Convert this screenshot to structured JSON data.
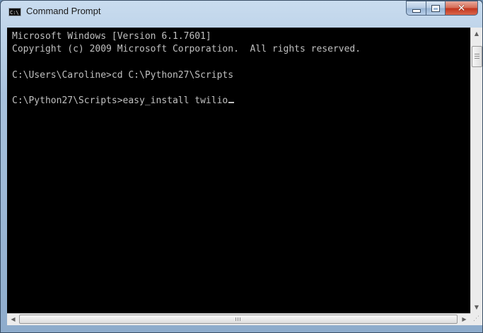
{
  "window": {
    "title": "Command Prompt",
    "icon": "cmd-app-icon",
    "icon_text": "C:\\",
    "buttons": {
      "minimize_icon": "minimize-icon",
      "maximize_icon": "maximize-icon",
      "close_icon": "close-icon",
      "close_glyph": "✕"
    }
  },
  "console": {
    "lines": [
      "Microsoft Windows [Version 6.1.7601]",
      "Copyright (c) 2009 Microsoft Corporation.  All rights reserved.",
      "",
      "C:\\Users\\Caroline>cd C:\\Python27\\Scripts",
      "",
      "C:\\Python27\\Scripts>easy_install twilio"
    ],
    "colors": {
      "background": "#000000",
      "text": "#c0c0c0"
    }
  },
  "scrollbars": {
    "up_arrow": "▲",
    "down_arrow": "▼",
    "left_arrow": "◀",
    "right_arrow": "▶",
    "grip": "⋰"
  }
}
